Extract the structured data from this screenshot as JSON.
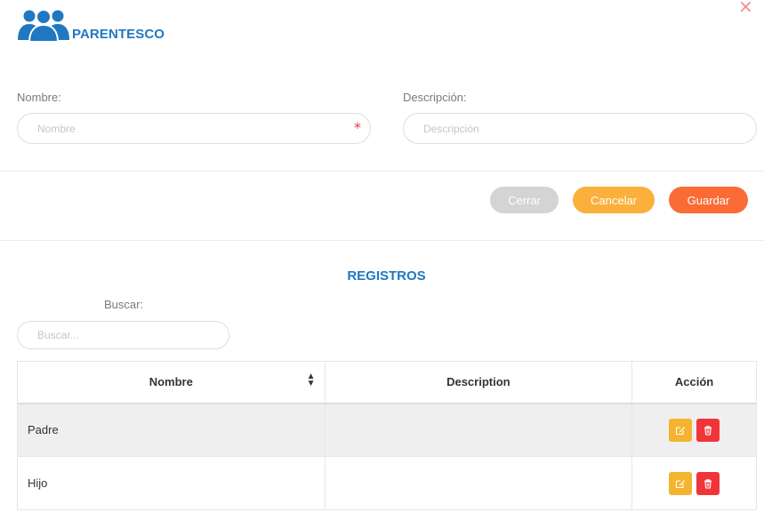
{
  "modal": {
    "close_glyph": "×",
    "title": "PARENTESCO",
    "icon": "users-icon",
    "brand_color": "#1f78c1"
  },
  "form": {
    "nombre_label": "Nombre:",
    "nombre_placeholder": "Nombre",
    "nombre_required_mark": "*",
    "descripcion_label": "Descripción:",
    "descripcion_placeholder": "Descripción"
  },
  "buttons": {
    "cerrar": {
      "label": "Cerrar",
      "color": "#d4d4d4"
    },
    "cancelar": {
      "label": "Cancelar",
      "color": "#fbb03b"
    },
    "guardar": {
      "label": "Guardar",
      "color": "#fb6b36"
    }
  },
  "registros": {
    "title": "REGISTROS",
    "search_label": "Buscar:",
    "search_placeholder": "Buscar...",
    "columns": [
      "Nombre",
      "Description",
      "Acción"
    ],
    "sort_icon": "sort-icon",
    "rows": [
      {
        "nombre": "Padre",
        "description": ""
      },
      {
        "nombre": "Hijo",
        "description": ""
      }
    ],
    "edit_color": "#f5b430",
    "delete_color": "#f0353a"
  }
}
